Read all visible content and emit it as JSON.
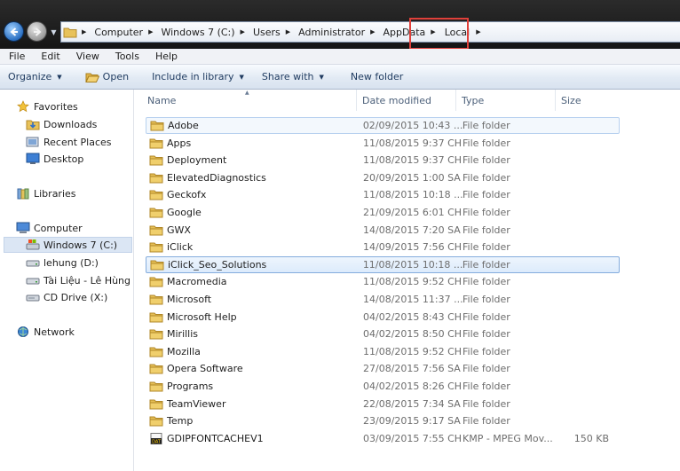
{
  "address": {
    "crumbs": [
      "Computer",
      "Windows 7 (C:)",
      "Users",
      "Administrator",
      "AppData",
      "Local"
    ]
  },
  "menu": [
    "File",
    "Edit",
    "View",
    "Tools",
    "Help"
  ],
  "toolbar": {
    "organize": "Organize",
    "open": "Open",
    "include_in_library": "Include in library",
    "share_with": "Share with",
    "new_folder": "New folder"
  },
  "nav": {
    "favorites": "Favorites",
    "downloads": "Downloads",
    "recent_places": "Recent Places",
    "desktop": "Desktop",
    "libraries": "Libraries",
    "computer": "Computer",
    "drive_c": "Windows 7 (C:)",
    "drive_d": "lehung (D:)",
    "drive_e": "Tài Liệu - Lê Hùng (",
    "drive_x": "CD Drive (X:)",
    "network": "Network"
  },
  "columns": {
    "name": "Name",
    "date_modified": "Date modified",
    "type": "Type",
    "size": "Size"
  },
  "files": [
    {
      "name": "Adobe",
      "date": "02/09/2015 10:43 ...",
      "type": "File folder",
      "size": "",
      "kind": "folder"
    },
    {
      "name": "Apps",
      "date": "11/08/2015 9:37 CH",
      "type": "File folder",
      "size": "",
      "kind": "folder"
    },
    {
      "name": "Deployment",
      "date": "11/08/2015 9:37 CH",
      "type": "File folder",
      "size": "",
      "kind": "folder"
    },
    {
      "name": "ElevatedDiagnostics",
      "date": "20/09/2015 1:00 SA",
      "type": "File folder",
      "size": "",
      "kind": "folder"
    },
    {
      "name": "Geckofx",
      "date": "11/08/2015 10:18 ...",
      "type": "File folder",
      "size": "",
      "kind": "folder"
    },
    {
      "name": "Google",
      "date": "21/09/2015 6:01 CH",
      "type": "File folder",
      "size": "",
      "kind": "folder"
    },
    {
      "name": "GWX",
      "date": "14/08/2015 7:20 SA",
      "type": "File folder",
      "size": "",
      "kind": "folder"
    },
    {
      "name": "iClick",
      "date": "14/09/2015 7:56 CH",
      "type": "File folder",
      "size": "",
      "kind": "folder"
    },
    {
      "name": "iClick_Seo_Solutions",
      "date": "11/08/2015 10:18 ...",
      "type": "File folder",
      "size": "",
      "kind": "folder"
    },
    {
      "name": "Macromedia",
      "date": "11/08/2015 9:52 CH",
      "type": "File folder",
      "size": "",
      "kind": "folder"
    },
    {
      "name": "Microsoft",
      "date": "14/08/2015 11:37 ...",
      "type": "File folder",
      "size": "",
      "kind": "folder"
    },
    {
      "name": "Microsoft Help",
      "date": "04/02/2015 8:43 CH",
      "type": "File folder",
      "size": "",
      "kind": "folder"
    },
    {
      "name": "Mirillis",
      "date": "04/02/2015 8:50 CH",
      "type": "File folder",
      "size": "",
      "kind": "folder"
    },
    {
      "name": "Mozilla",
      "date": "11/08/2015 9:52 CH",
      "type": "File folder",
      "size": "",
      "kind": "folder"
    },
    {
      "name": "Opera Software",
      "date": "27/08/2015 7:56 SA",
      "type": "File folder",
      "size": "",
      "kind": "folder"
    },
    {
      "name": "Programs",
      "date": "04/02/2015 8:26 CH",
      "type": "File folder",
      "size": "",
      "kind": "folder"
    },
    {
      "name": "TeamViewer",
      "date": "22/08/2015 7:34 SA",
      "type": "File folder",
      "size": "",
      "kind": "folder"
    },
    {
      "name": "Temp",
      "date": "23/09/2015 9:17 SA",
      "type": "File folder",
      "size": "",
      "kind": "folder"
    },
    {
      "name": "GDIPFONTCACHEV1",
      "date": "03/09/2015 7:55 CH",
      "type": "KMP - MPEG Mov...",
      "size": "150 KB",
      "kind": "dat"
    }
  ]
}
